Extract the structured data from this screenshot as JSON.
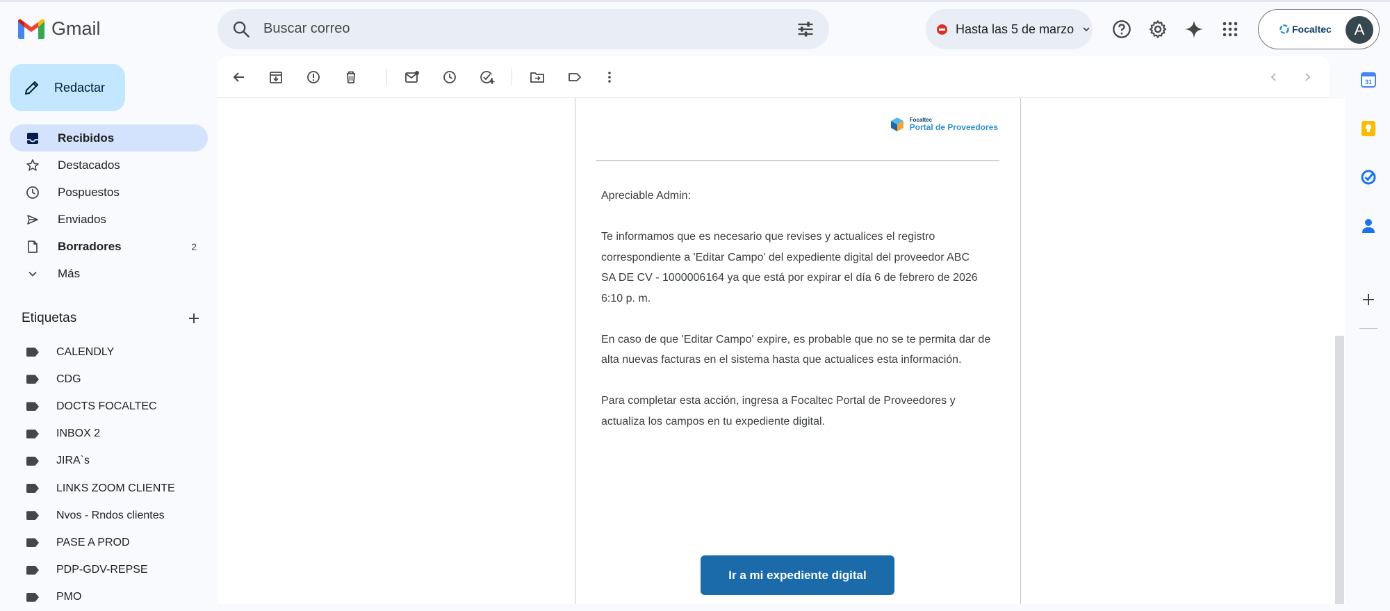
{
  "app": {
    "name": "Gmail"
  },
  "search": {
    "placeholder": "Buscar correo"
  },
  "status": {
    "label": "Hasta las 5 de marzo"
  },
  "account": {
    "org": "Focaltec",
    "avatar_letter": "A"
  },
  "compose": {
    "label": "Redactar"
  },
  "nav": [
    {
      "id": "inbox",
      "label": "Recibidos",
      "count": "",
      "active": true,
      "bold": true,
      "icon": "inbox-icon"
    },
    {
      "id": "starred",
      "label": "Destacados",
      "count": "",
      "active": false,
      "bold": false,
      "icon": "star-icon"
    },
    {
      "id": "snoozed",
      "label": "Pospuestos",
      "count": "",
      "active": false,
      "bold": false,
      "icon": "clock-icon"
    },
    {
      "id": "sent",
      "label": "Enviados",
      "count": "",
      "active": false,
      "bold": false,
      "icon": "send-icon"
    },
    {
      "id": "drafts",
      "label": "Borradores",
      "count": "2",
      "active": false,
      "bold": true,
      "icon": "draft-icon"
    },
    {
      "id": "more",
      "label": "Más",
      "count": "",
      "active": false,
      "bold": false,
      "icon": "chevron-down-icon"
    }
  ],
  "labels_header": "Etiquetas",
  "labels": [
    "CALENDLY",
    "CDG",
    "DOCTS FOCALTEC",
    "INBOX 2",
    "JIRA`s",
    "LINKS ZOOM CLIENTE",
    "Nvos - Rndos clientes",
    "PASE A PROD",
    "PDP-GDV-REPSE",
    "PMO"
  ],
  "email": {
    "brand_small": "Focaltec",
    "brand_big": "Portal de Proveedores",
    "greeting": "Apreciable Admin:",
    "paragraph1": "Te informamos que es necesario que revises y actualices el registro correspondiente a 'Editar Campo' del expediente digital del proveedor ABC                       SA DE CV - 1000006164 ya que está por expirar el día 6 de febrero de 2026 6:10 p. m.",
    "paragraph2": "En caso de que 'Editar Campo' expire, es probable que no se te permita dar de alta nuevas facturas en el sistema hasta que actualices esta información.",
    "paragraph3": "Para completar esta acción, ingresa a Focaltec Portal de Proveedores y actualiza los campos en tu expediente digital.",
    "cta": "Ir a mi expediente digital"
  },
  "colors": {
    "accent": "#c2e7ff",
    "active_nav": "#d3e3fd",
    "cta": "#1b6bab",
    "dnd": "#d93025"
  }
}
